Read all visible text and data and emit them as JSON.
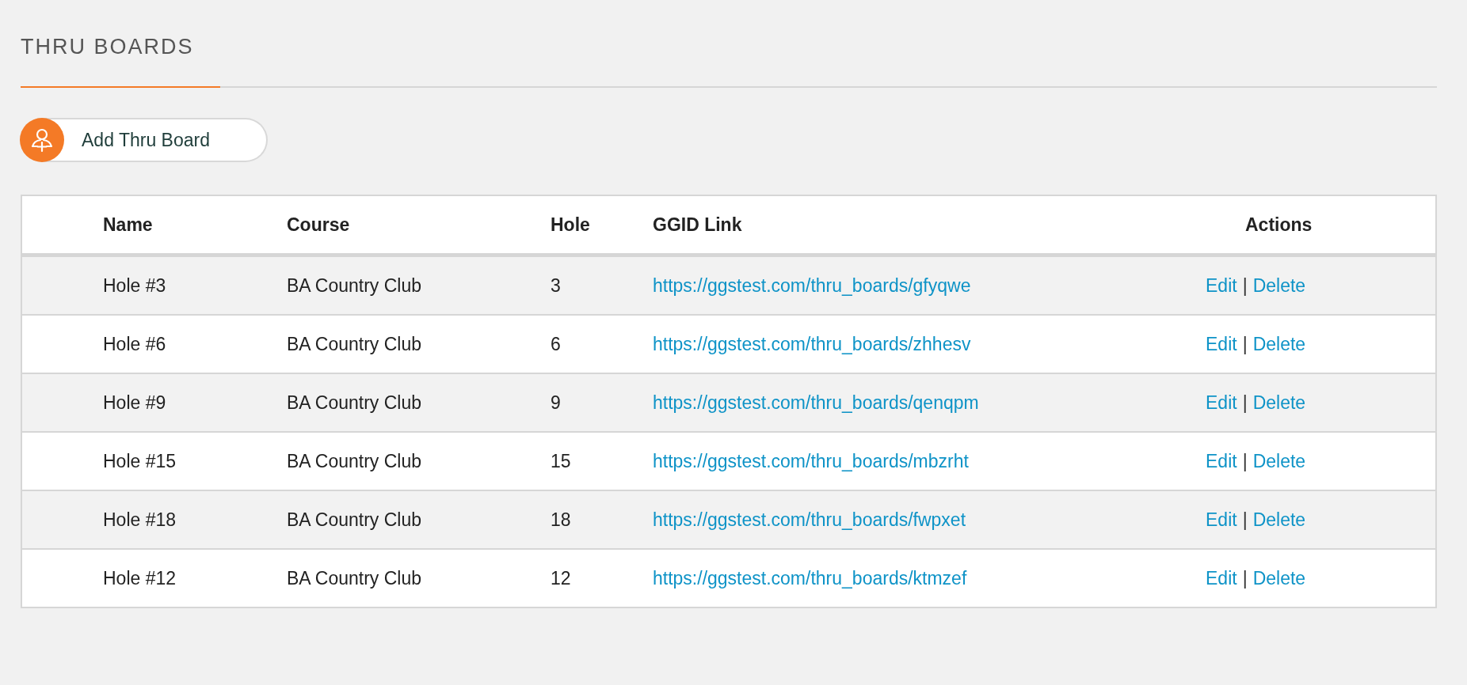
{
  "page": {
    "title": "THRU BOARDS"
  },
  "add_button": {
    "label": "Add Thru Board"
  },
  "table": {
    "columns": [
      "Name",
      "Course",
      "Hole",
      "GGID Link",
      "Actions"
    ],
    "rows": [
      {
        "name": "Hole #3",
        "course": "BA Country Club",
        "hole": "3",
        "link": "https://ggstest.com/thru_boards/gfyqwe",
        "actions": [
          "Edit",
          "Delete"
        ],
        "separator": "|"
      },
      {
        "name": "Hole #6",
        "course": "BA Country Club",
        "hole": "6",
        "link": "https://ggstest.com/thru_boards/zhhesv",
        "actions": [
          "Edit",
          "Delete"
        ],
        "separator": "|"
      },
      {
        "name": "Hole #9",
        "course": "BA Country Club",
        "hole": "9",
        "link": "https://ggstest.com/thru_boards/qenqpm",
        "actions": [
          "Edit",
          "Delete"
        ],
        "separator": "|"
      },
      {
        "name": "Hole #15",
        "course": "BA Country Club",
        "hole": "15",
        "link": "https://ggstest.com/thru_boards/mbzrht",
        "actions": [
          "Edit",
          "Delete"
        ],
        "separator": "|"
      },
      {
        "name": "Hole #18",
        "course": "BA Country Club",
        "hole": "18",
        "link": "https://ggstest.com/thru_boards/fwpxet",
        "actions": [
          "Edit",
          "Delete"
        ],
        "separator": "|"
      },
      {
        "name": "Hole #12",
        "course": "BA Country Club",
        "hole": "12",
        "link": "https://ggstest.com/thru_boards/ktmzef",
        "actions": [
          "Edit",
          "Delete"
        ],
        "separator": "|"
      }
    ]
  }
}
